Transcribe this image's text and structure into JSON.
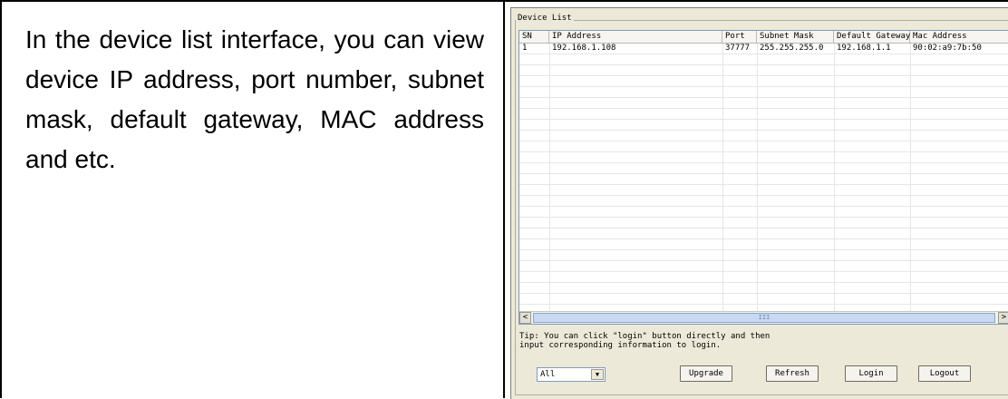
{
  "document": {
    "text": "In the device list interface, you can view device IP address, port number, subnet mask, default gateway, MAC address and etc."
  },
  "device_list": {
    "title": "Device List",
    "columns": [
      "SN",
      "IP Address",
      "Port",
      "Subnet Mask",
      "Default Gateway",
      "Mac Address"
    ],
    "rows": [
      {
        "sn": "1",
        "ip": "192.168.1.108",
        "port": "37777",
        "mask": "255.255.255.0",
        "gateway": "192.168.1.1",
        "mac": "90:02:a9:7b:50"
      }
    ],
    "scroll_left": "<",
    "scroll_right": ">",
    "scroll_grip": "III",
    "tip": "Tip: You can click \"login\" button directly and then input corresponding information to login.",
    "filter_value": "All",
    "buttons": {
      "upgrade": "Upgrade",
      "refresh": "Refresh",
      "login": "Login",
      "logout": "Logout"
    }
  }
}
